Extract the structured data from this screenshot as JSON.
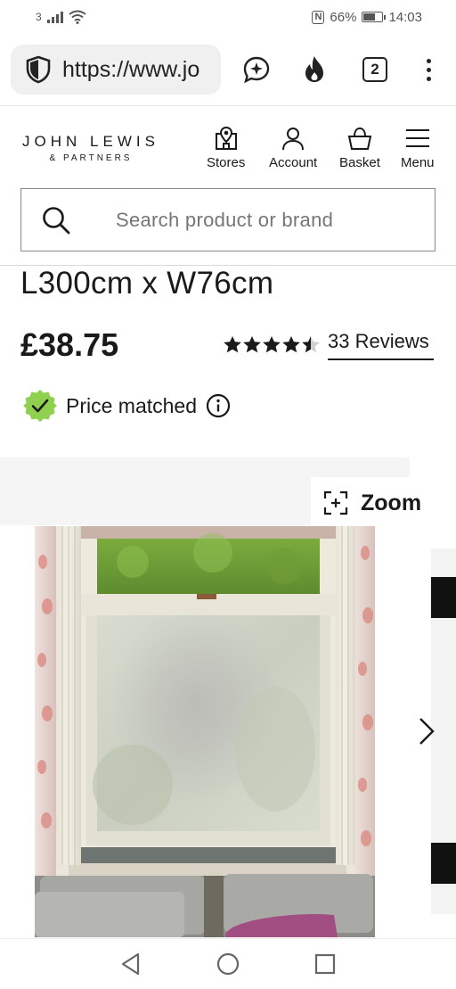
{
  "status_bar": {
    "sim_label": "3",
    "nfc_label": "N",
    "battery_percent": "66%",
    "battery_level": 0.66,
    "time": "14:03"
  },
  "browser": {
    "url": "https://www.jo",
    "tab_count": "2",
    "icons": [
      "shield-icon",
      "assistant-icon",
      "flame-icon",
      "tabs-icon",
      "more-menu-icon"
    ]
  },
  "header": {
    "logo_main": "JOHN LEWIS",
    "logo_sub": "& PARTNERS",
    "nav": {
      "stores": "Stores",
      "account": "Account",
      "basket": "Basket",
      "menu": "Menu"
    }
  },
  "search": {
    "placeholder": "Search product or brand"
  },
  "product": {
    "title": "L300cm x W76cm",
    "price": "£38.75",
    "rating": 4.5,
    "rating_max": 5,
    "reviews_label": "33 Reviews",
    "price_match_label": "Price matched"
  },
  "gallery": {
    "zoom_label": "Zoom"
  },
  "colors": {
    "brand_text": "#1a1a1a",
    "price_match_badge": "#8fd14f",
    "photo_border_grey": "#f5f5f5"
  }
}
